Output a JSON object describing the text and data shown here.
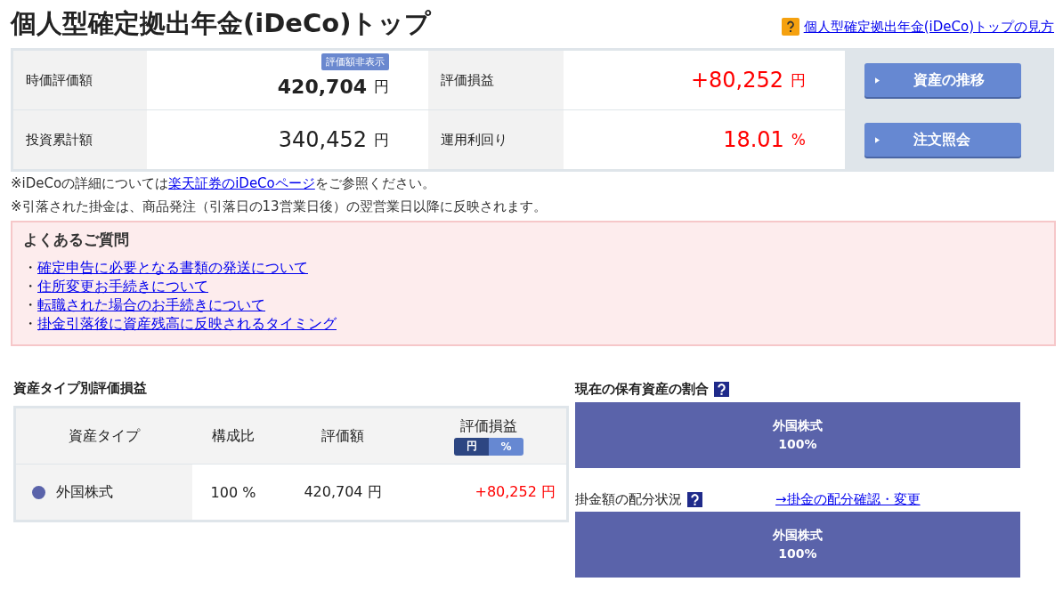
{
  "title": "個人型確定拠出年金(iDeCo)トップ",
  "help_link": "個人型確定拠出年金(iDeCo)トップの見方",
  "summary": {
    "rows": [
      {
        "label": "時価評価額",
        "badge": "評価額非表示",
        "value": "420,704",
        "unit": "円",
        "label2": "評価損益",
        "value2": "+80,252",
        "unit2": "円",
        "button": "資産の推移"
      },
      {
        "label": "投資累計額",
        "value": "340,452",
        "unit": "円",
        "label2": "運用利回り",
        "value2": "18.01",
        "unit2": "%",
        "button": "注文照会"
      }
    ]
  },
  "notes": [
    {
      "before": "※iDeCoの詳細については",
      "link": "楽天証券のiDeCoページ",
      "after": "をご参照ください。"
    },
    {
      "before": "※引落された掛金は、商品発注（引落日の13営業日後）の翌営業日以降に反映されます。"
    }
  ],
  "faq": {
    "title": "よくあるご質問",
    "items": [
      {
        "bullet": "・",
        "text": "確定申告に必要となる書類の発送について"
      },
      {
        "bullet": "・",
        "text": "住所変更お手続きについて"
      },
      {
        "bullet": "・",
        "text": "転職された場合のお手続きについて"
      },
      {
        "bullet": "・",
        "text": "掛金引落後に資産残高に反映されるタイミング"
      }
    ]
  },
  "asset_table": {
    "title": "資産タイプ別評価損益",
    "columns": [
      "資産タイプ",
      "構成比",
      "評価額",
      "評価損益"
    ],
    "unit_toggle": [
      {
        "label": "円",
        "selected": true
      },
      {
        "label": "%",
        "selected": false
      }
    ],
    "rows": [
      {
        "type": "外国株式",
        "color": "#5a63aa",
        "ratio": "100 %",
        "value": "420,704 円",
        "gain": "+80,252 円"
      }
    ]
  },
  "holdings": {
    "title": "現在の保有資産の割合",
    "segments": [
      {
        "name": "外国株式",
        "percent": "100%",
        "color": "#5a63aa"
      }
    ]
  },
  "allocation": {
    "title": "掛金額の配分状況",
    "link": "→掛金の配分確認・変更",
    "segments": [
      {
        "name": "外国株式",
        "percent": "100%",
        "color": "#5a63aa"
      }
    ]
  }
}
